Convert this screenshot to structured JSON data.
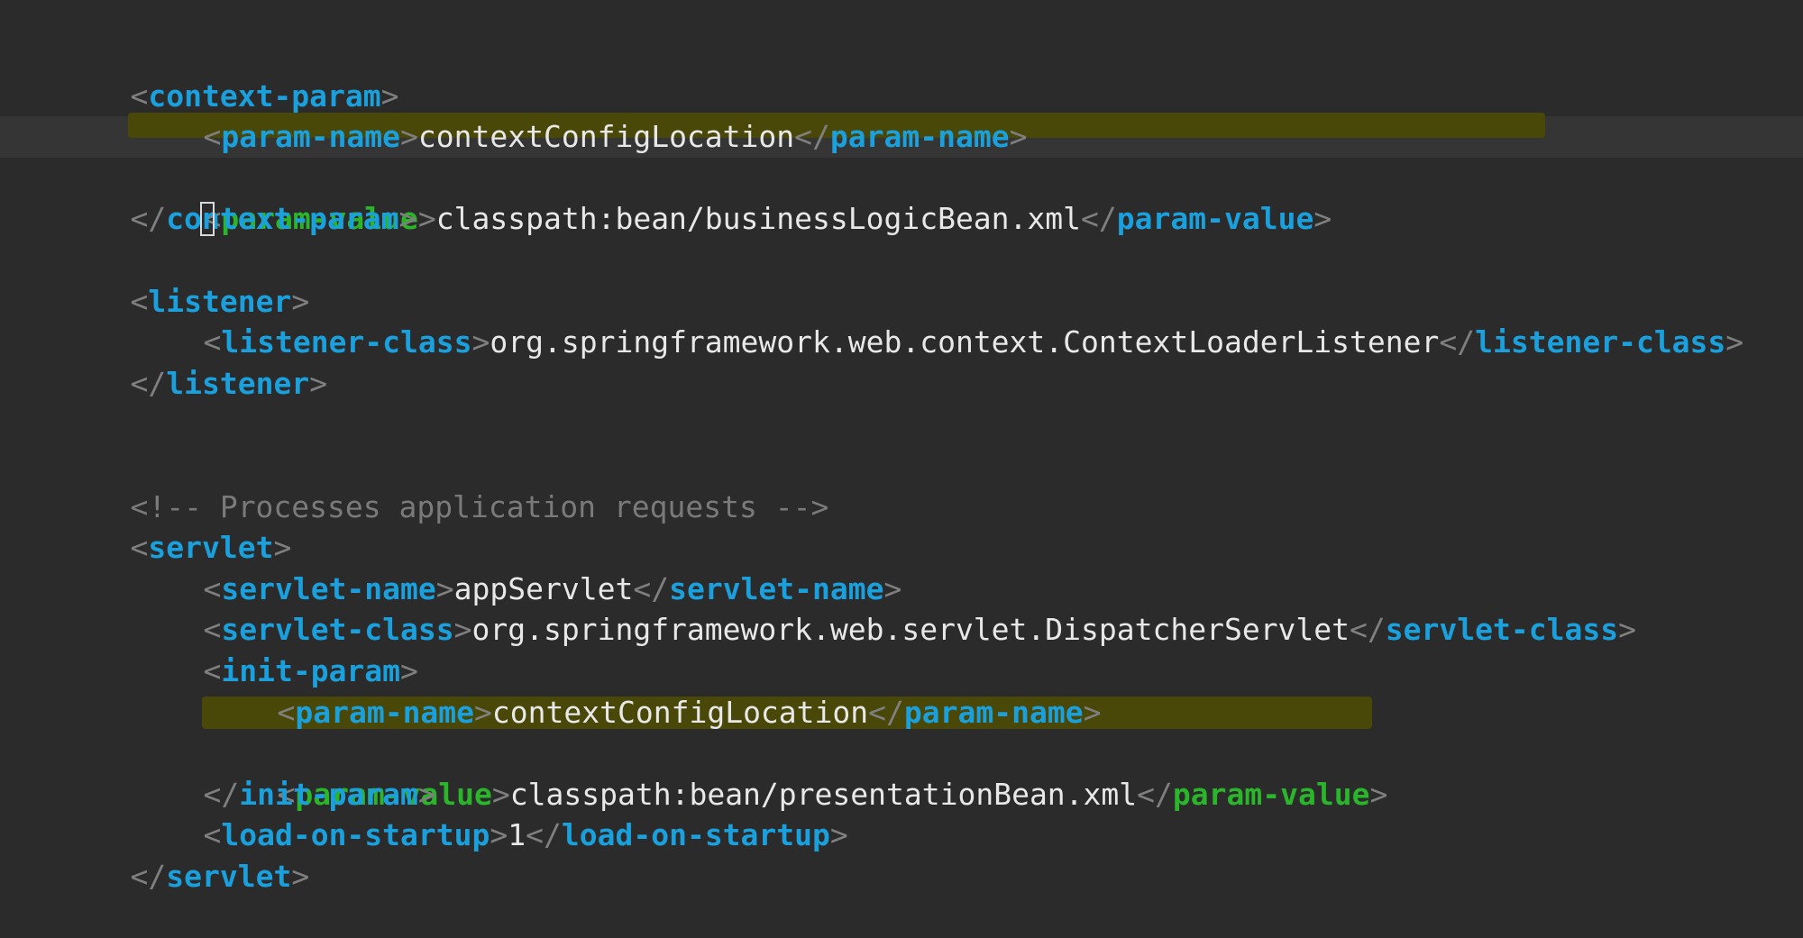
{
  "editor": {
    "lines": [
      {
        "open": "<",
        "tag": "context-param",
        "close": ">"
      },
      {
        "pn_open": "<",
        "pn_tag": "param-name",
        "pn_gt": ">",
        "value": "contextConfigLocation",
        "pn_end_open": "</",
        "pn_end_tag": "param-name",
        "pn_end_gt": ">"
      },
      {
        "pv_open": "<",
        "pv_tag": "param-value",
        "pv_gt": ">",
        "value": "classpath:bean/businessLogicBean.xml",
        "pv_end_open": "</",
        "pv_end_tag": "param-value",
        "pv_end_gt": ">"
      },
      {
        "open": "</",
        "tag": "context-param",
        "close": ">"
      },
      {
        "open": "<",
        "tag": "listener",
        "close": ">"
      },
      {
        "o1": "<",
        "tag": "listener-class",
        "g1": ">",
        "value": "org.springframework.web.context.ContextLoaderListener",
        "o2": "</",
        "end_tag": "listener-class",
        "g2": ">"
      },
      {
        "open": "</",
        "tag": "listener",
        "close": ">"
      },
      {
        "comment": "<!-- Processes application requests -->"
      },
      {
        "open": "<",
        "tag": "servlet",
        "close": ">"
      },
      {
        "o1": "<",
        "tag": "servlet-name",
        "g1": ">",
        "value": "appServlet",
        "o2": "</",
        "end_tag": "servlet-name",
        "g2": ">"
      },
      {
        "o1": "<",
        "tag": "servlet-class",
        "g1": ">",
        "value": "org.springframework.web.servlet.DispatcherServlet",
        "o2": "</",
        "end_tag": "servlet-class",
        "g2": ">"
      },
      {
        "open": "<",
        "tag": "init-param",
        "close": ">"
      },
      {
        "o1": "<",
        "tag": "param-name",
        "g1": ">",
        "value": "contextConfigLocation",
        "o2": "</",
        "end_tag": "param-name",
        "g2": ">"
      },
      {
        "o1": "<",
        "tag": "param-value",
        "g1": ">",
        "value": "classpath:bean/presentationBean.xml",
        "o2": "</",
        "end_tag": "param-value",
        "g2": ">"
      },
      {
        "open": "</",
        "tag": "init-param",
        "close": ">"
      },
      {
        "o1": "<",
        "tag": "load-on-startup",
        "g1": ">",
        "value": "1",
        "o2": "</",
        "end_tag": "load-on-startup",
        "g2": ">"
      },
      {
        "open": "</",
        "tag": "servlet",
        "close": ">"
      }
    ]
  },
  "colors": {
    "background": "#2b2b2b",
    "tag": "#1aa0dc",
    "highlighted_tag": "#2ab52a",
    "bracket": "#7f7f7f",
    "text": "#e8e8e8",
    "comment": "#7a7a7a",
    "highlight": "#4a4808"
  }
}
